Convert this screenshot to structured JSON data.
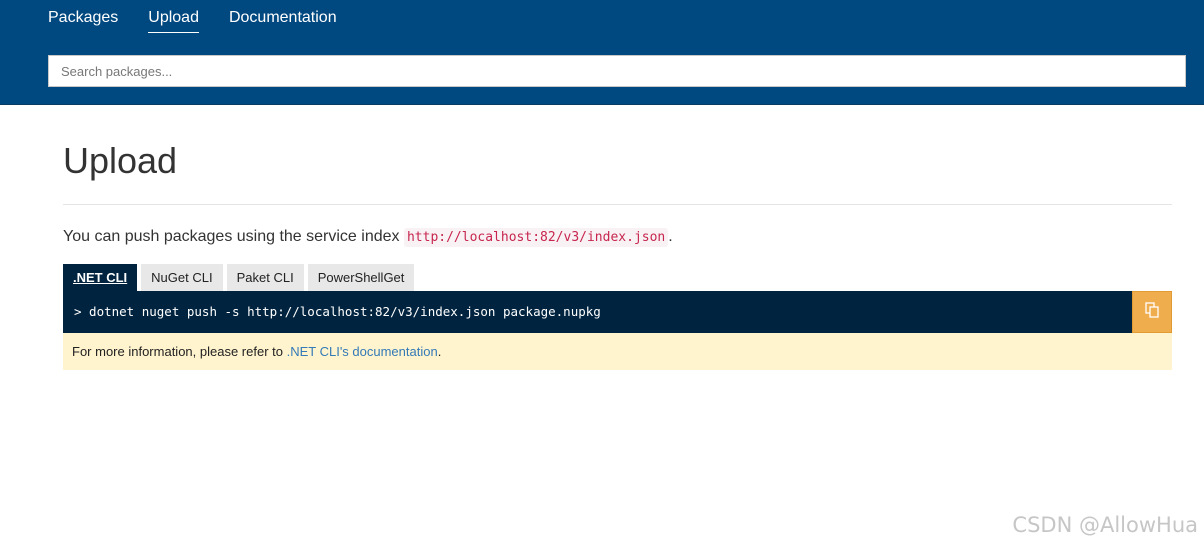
{
  "nav": {
    "items": [
      {
        "label": "Packages",
        "active": false
      },
      {
        "label": "Upload",
        "active": true
      },
      {
        "label": "Documentation",
        "active": false
      }
    ]
  },
  "search": {
    "placeholder": "Search packages...",
    "value": ""
  },
  "main": {
    "title": "Upload",
    "intro_prefix": "You can push packages using the service index ",
    "service_index_url": "http://localhost:82/v3/index.json",
    "intro_suffix": ".",
    "tabs": [
      {
        "label": ".NET CLI",
        "active": true
      },
      {
        "label": "NuGet CLI",
        "active": false
      },
      {
        "label": "Paket CLI",
        "active": false
      },
      {
        "label": "PowerShellGet",
        "active": false
      }
    ],
    "command": "> dotnet nuget push -s http://localhost:82/v3/index.json package.nupkg",
    "copy_icon": "copy-icon",
    "info_prefix": "For more information, please refer to ",
    "info_link": ".NET CLI's documentation",
    "info_suffix": "."
  },
  "watermark": "CSDN @AllowHua",
  "colors": {
    "header_bg": "#004880",
    "command_bg": "#002440",
    "copy_button": "#f0ad4e",
    "info_bg": "#fff4ce",
    "url_code": "#c7254e",
    "link": "#337ab7"
  }
}
